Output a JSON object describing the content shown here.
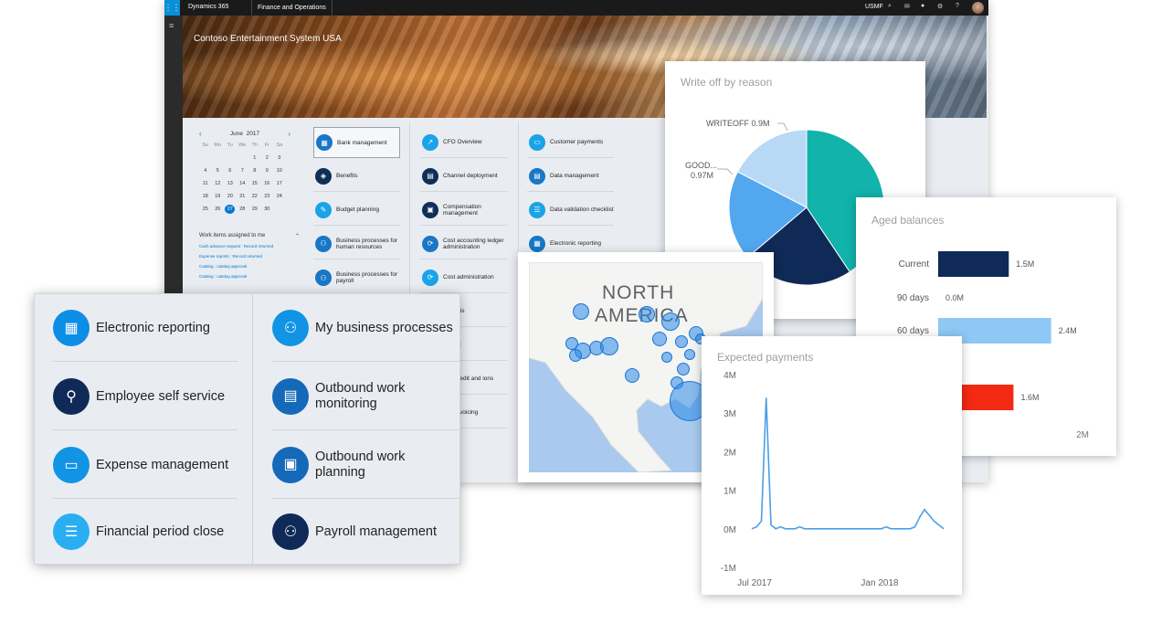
{
  "topbar": {
    "brand": "Dynamics 365",
    "module": "Finance and Operations",
    "company_code": "USMF"
  },
  "hero": {
    "company": "Contoso Entertainment System USA"
  },
  "calendar": {
    "month": "June",
    "year": "2017",
    "days_header": [
      "Su",
      "Mo",
      "Tu",
      "We",
      "Th",
      "Fr",
      "Sa"
    ],
    "cells": [
      "",
      "",
      "",
      "",
      "1",
      "2",
      "3",
      "4",
      "5",
      "6",
      "7",
      "8",
      "9",
      "10",
      "11",
      "12",
      "13",
      "14",
      "15",
      "16",
      "17",
      "18",
      "19",
      "20",
      "21",
      "22",
      "23",
      "24",
      "25",
      "26",
      "27",
      "28",
      "29",
      "30",
      ""
    ],
    "today": "27"
  },
  "work_items": {
    "heading": "Work items assigned to me",
    "items": [
      "Cash advance request : Record returned",
      "Expense reports : Record returned",
      "Catalog : catalog approval",
      "Catalog : catalog approval"
    ]
  },
  "tiles": {
    "col1": [
      "Bank management",
      "Benefits",
      "Budget planning",
      "Business processes for human resources",
      "Business processes for payroll"
    ],
    "col2": [
      "CFO Overview",
      "Channel deployment",
      "Compensation management",
      "Cost accounting ledger administration",
      "Cost administration",
      "analysis",
      "control",
      "mer credit and ions",
      "mer invoicing"
    ],
    "col3": [
      "Customer payments",
      "Data management",
      "Data validation checklist",
      "Electronic reporting"
    ]
  },
  "workspaces": {
    "left": [
      "Electronic reporting",
      "Employee self service",
      "Expense management",
      "Financial period close"
    ],
    "right": [
      "My business processes",
      "Outbound work monitoring",
      "Outbound work planning",
      "Payroll management"
    ]
  },
  "colors": {
    "accent": "#0078d4",
    "teal": "#11b3aa",
    "navy": "#0f2a57",
    "light_blue": "#8ec8f5",
    "red": "#f32914"
  },
  "chart_data": [
    {
      "type": "pie",
      "title": "Write off by reason",
      "slices": [
        {
          "name": "",
          "value": 2.1,
          "color": "#11b3aa"
        },
        {
          "name": "",
          "value": 1.2,
          "color": "#0f2a57"
        },
        {
          "name": "GOOD...",
          "label": "0.97M",
          "value": 0.97,
          "color": "#52a7ee"
        },
        {
          "name": "WRITEOFF",
          "label": "0.9M",
          "value": 0.9,
          "color": "#b8d9f6"
        }
      ]
    },
    {
      "type": "bar",
      "title": "Aged balances",
      "categories": [
        "Current",
        "90 days",
        "60 days",
        "",
        ""
      ],
      "values": [
        1.5,
        0.0,
        2.4,
        0,
        1.6
      ],
      "value_labels": [
        "1.5M",
        "0.0M",
        "2.4M",
        "",
        "1.6M"
      ],
      "colors": [
        "#0f2a57",
        "#0f2a57",
        "#8ec8f5",
        "#8ec8f5",
        "#f32914"
      ],
      "xmax": 2.6,
      "axis_label": "2M"
    },
    {
      "type": "map",
      "labels": [
        "NORTH",
        "AMERICA"
      ]
    },
    {
      "type": "line",
      "title": "Expected payments",
      "y_ticks": [
        "4M",
        "3M",
        "2M",
        "1M",
        "0M",
        "-1M"
      ],
      "x_ticks": [
        "Jul 2017",
        "Jan 2018"
      ],
      "ylim": [
        -1,
        4
      ],
      "x": [
        0,
        1,
        2,
        3,
        4,
        5,
        6,
        7,
        8,
        9,
        10,
        11,
        12,
        13,
        14,
        15,
        16,
        17,
        18,
        19,
        20,
        21,
        22,
        23,
        24,
        25,
        26,
        27,
        28,
        29,
        30,
        31,
        32,
        33,
        34,
        35,
        36,
        37,
        38,
        39,
        40
      ],
      "values": [
        0.0,
        0.05,
        0.2,
        3.4,
        0.1,
        0.0,
        0.05,
        0.0,
        0.0,
        0.0,
        0.05,
        0.0,
        0.0,
        0.0,
        0.0,
        0.0,
        0.0,
        0.0,
        0.0,
        0.0,
        0.0,
        0.0,
        0.0,
        0.0,
        0.0,
        0.0,
        0.0,
        0.0,
        0.05,
        0.0,
        0.0,
        0.0,
        0.0,
        0.0,
        0.05,
        0.3,
        0.5,
        0.35,
        0.2,
        0.1,
        0.0
      ]
    }
  ]
}
